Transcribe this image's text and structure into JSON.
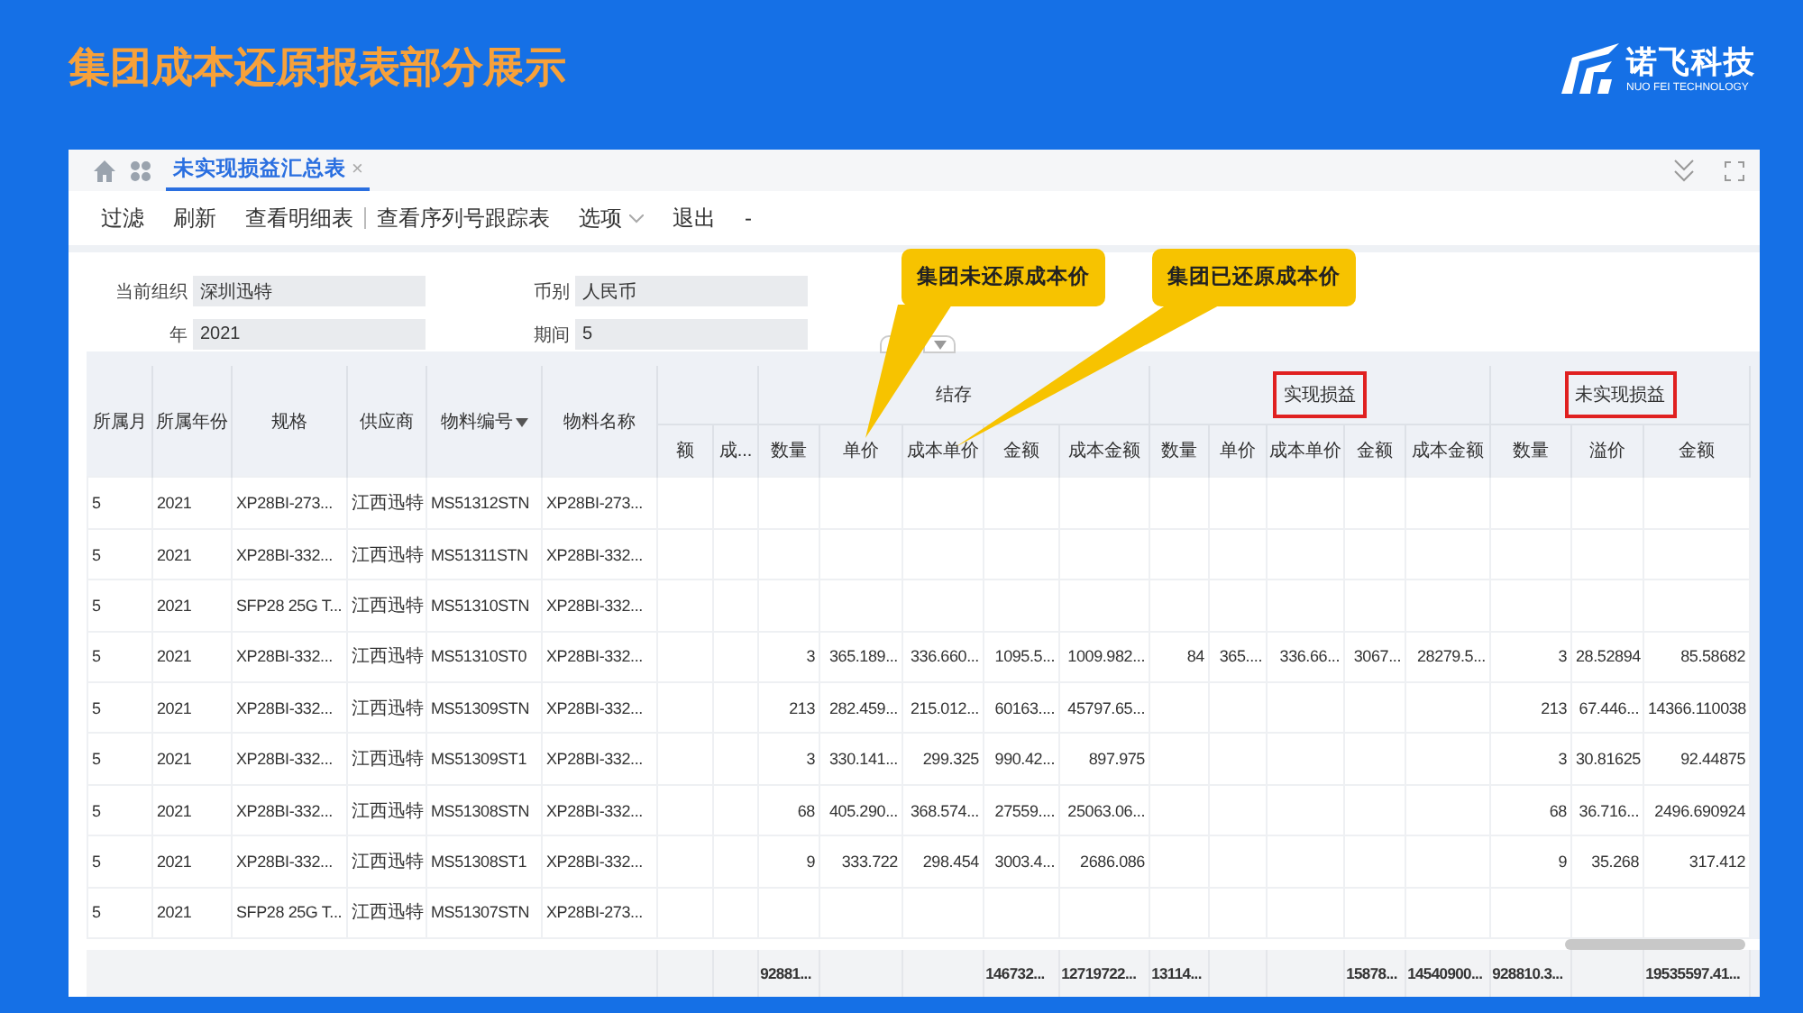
{
  "slide": {
    "title": "集团成本还原报表部分展示",
    "logo": {
      "name": "诺飞科技",
      "tagline": "NUO FEI TECHNOLOGY"
    }
  },
  "tabs": [
    {
      "label": "未实现损益汇总表",
      "selected": true,
      "close": "×"
    }
  ],
  "toolbar": [
    {
      "kind": "button",
      "label": "过滤"
    },
    {
      "kind": "button",
      "label": "刷新"
    },
    {
      "kind": "button",
      "label": "查看明细表"
    },
    {
      "kind": "separator"
    },
    {
      "kind": "button",
      "label": "查看序列号跟踪表"
    },
    {
      "kind": "dropdown",
      "label": "选项"
    },
    {
      "kind": "button",
      "label": "退出"
    },
    {
      "kind": "button",
      "label": "-"
    }
  ],
  "filters": [
    {
      "label": "当前组织",
      "value": "深圳迅特"
    },
    {
      "label": "币别",
      "value": "人民币"
    },
    {
      "label": "年",
      "value": "2021"
    },
    {
      "label": "期间",
      "value": "5"
    }
  ],
  "callouts": [
    {
      "text": "集团未还原成本价"
    },
    {
      "text": "集团已还原成本价"
    }
  ],
  "table": {
    "fixed_columns": [
      {
        "label": "所属月",
        "sorted": false
      },
      {
        "label": "所属年份",
        "sorted": false
      },
      {
        "label": "规格",
        "sorted": false
      },
      {
        "label": "供应商",
        "sorted": false
      },
      {
        "label": "物料编号",
        "sorted": true
      },
      {
        "label": "物料名称",
        "sorted": false
      }
    ],
    "groups": [
      {
        "kind": "partial",
        "columns": [
          {
            "label": "额"
          },
          {
            "label": "成..."
          }
        ]
      },
      {
        "kind": "stock",
        "label": "结存",
        "highlighted": false,
        "columns": [
          {
            "label": "数量",
            "total": "92881..."
          },
          {
            "label": "单价"
          },
          {
            "label": "成本单价"
          },
          {
            "label": "金额",
            "total": "146732..."
          },
          {
            "label": "成本金额",
            "total": "12719722..."
          }
        ]
      },
      {
        "kind": "realized",
        "label": "实现损益",
        "highlighted": true,
        "columns": [
          {
            "label": "数量",
            "total": "13114..."
          },
          {
            "label": "单价"
          },
          {
            "label": "成本单价"
          },
          {
            "label": "金额",
            "total": "15878..."
          },
          {
            "label": "成本金额",
            "total": "14540900..."
          }
        ]
      },
      {
        "kind": "unrealized",
        "label": "未实现损益",
        "highlighted": true,
        "columns": [
          {
            "label": "数量",
            "total": "928810.3..."
          },
          {
            "label": "溢价"
          },
          {
            "label": "金额",
            "total": "19535597.41..."
          }
        ]
      }
    ],
    "rows": [
      {
        "cells": [
          "5",
          "2021",
          "XP28BI-273...",
          "江西迅特",
          "MS51312STN",
          "XP28BI-273..."
        ]
      },
      {
        "cells": [
          "5",
          "2021",
          "XP28BI-332...",
          "江西迅特",
          "MS51311STN",
          "XP28BI-332..."
        ]
      },
      {
        "cells": [
          "5",
          "2021",
          "SFP28 25G T...",
          "江西迅特",
          "MS51310STN",
          "XP28BI-332..."
        ]
      },
      {
        "cells": [
          "5",
          "2021",
          "XP28BI-332...",
          "江西迅特",
          "MS51310ST0",
          "XP28BI-332..."
        ],
        "stock": [
          "3",
          "365.189...",
          "336.660...",
          "1095.5...",
          "1009.982..."
        ],
        "realized": [
          "84",
          "365....",
          "336.66...",
          "3067...",
          "28279.5..."
        ],
        "unrealized": [
          "3",
          "28.52894",
          "85.58682"
        ]
      },
      {
        "cells": [
          "5",
          "2021",
          "XP28BI-332...",
          "江西迅特",
          "MS51309STN",
          "XP28BI-332..."
        ],
        "stock": [
          "213",
          "282.459...",
          "215.012...",
          "60163....",
          "45797.65..."
        ],
        "unrealized": [
          "213",
          "67.446...",
          "14366.110038"
        ]
      },
      {
        "cells": [
          "5",
          "2021",
          "XP28BI-332...",
          "江西迅特",
          "MS51309ST1",
          "XP28BI-332..."
        ],
        "stock": [
          "3",
          "330.141...",
          "299.325",
          "990.42...",
          "897.975"
        ],
        "unrealized": [
          "3",
          "30.81625",
          "92.44875"
        ]
      },
      {
        "cells": [
          "5",
          "2021",
          "XP28BI-332...",
          "江西迅特",
          "MS51308STN",
          "XP28BI-332..."
        ],
        "stock": [
          "68",
          "405.290...",
          "368.574...",
          "27559....",
          "25063.06..."
        ],
        "unrealized": [
          "68",
          "36.716...",
          "2496.690924"
        ]
      },
      {
        "cells": [
          "5",
          "2021",
          "XP28BI-332...",
          "江西迅特",
          "MS51308ST1",
          "XP28BI-332..."
        ],
        "stock": [
          "9",
          "333.722",
          "298.454",
          "3003.4...",
          "2686.086"
        ],
        "unrealized": [
          "9",
          "35.268",
          "317.412"
        ]
      },
      {
        "cells": [
          "5",
          "2021",
          "SFP28 25G T...",
          "江西迅特",
          "MS51307STN",
          "XP28BI-273..."
        ]
      }
    ]
  }
}
